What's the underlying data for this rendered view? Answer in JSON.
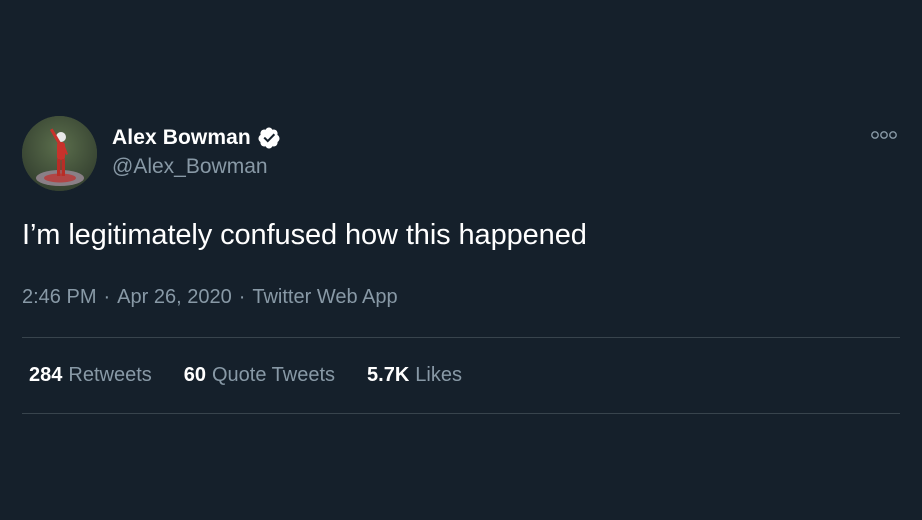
{
  "tweet": {
    "display_name": "Alex Bowman",
    "handle": "@Alex_Bowman",
    "verified": true,
    "text": "I’m legitimately confused how this happened",
    "time": "2:46 PM",
    "date": "Apr 26, 2020",
    "source": "Twitter Web App",
    "separator": "·"
  },
  "stats": {
    "retweets": {
      "count": "284",
      "label": "Retweets"
    },
    "quote_tweets": {
      "count": "60",
      "label": "Quote Tweets"
    },
    "likes": {
      "count": "5.7K",
      "label": "Likes"
    }
  },
  "icons": {
    "avatar": "avatar-image",
    "verified": "verified-badge-icon",
    "more": "more-options-icon"
  },
  "colors": {
    "background": "#15202b",
    "text_primary": "#ffffff",
    "text_secondary": "#8899a6",
    "divider": "#38444d"
  }
}
